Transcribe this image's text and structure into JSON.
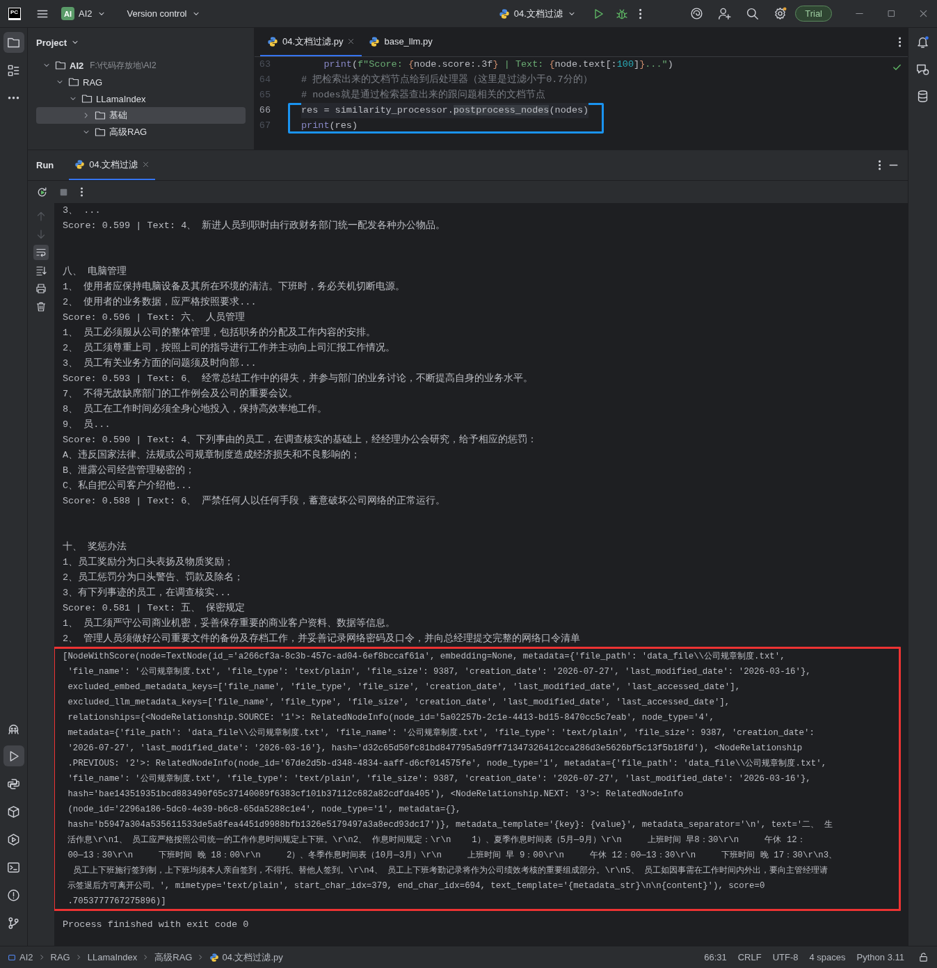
{
  "title_bar": {
    "logo": "PC",
    "project_badge": "AI",
    "project": "AI2",
    "vcs": "Version control",
    "run_config": "04.文档过滤",
    "trial": "Trial"
  },
  "left_strip": {
    "top": [
      {
        "kind": "project",
        "selected": true
      },
      {
        "kind": "structure",
        "selected": false
      },
      {
        "kind": "more",
        "selected": false
      }
    ],
    "bottom": [
      {
        "kind": "ai",
        "selected": false
      },
      {
        "kind": "run",
        "selected": true
      },
      {
        "kind": "python_console",
        "selected": false
      },
      {
        "kind": "packages",
        "selected": false
      },
      {
        "kind": "services",
        "selected": false
      },
      {
        "kind": "terminal",
        "selected": false
      },
      {
        "kind": "problems",
        "selected": false
      },
      {
        "kind": "git",
        "selected": false
      }
    ]
  },
  "project_panel": {
    "title": "Project",
    "tree": [
      {
        "label": "AI2",
        "path": "F:\\代码存放地\\AI2",
        "expanded": true,
        "selected": false,
        "children": [
          {
            "label": "RAG",
            "expanded": true,
            "selected": false,
            "children": [
              {
                "label": "LLamaIndex",
                "expanded": true,
                "selected": false,
                "children": [
                  {
                    "label": "基础",
                    "expanded": false,
                    "selected": true
                  },
                  {
                    "label": "高级RAG",
                    "expanded": true,
                    "selected": false
                  }
                ]
              }
            ]
          }
        ]
      }
    ]
  },
  "editor": {
    "tabs": [
      {
        "label": "04.文档过滤.py",
        "selected": true
      },
      {
        "label": "base_llm.py",
        "selected": false
      }
    ],
    "lines": [
      {
        "number": "63",
        "indented": true,
        "current": false,
        "boxed": false,
        "tokens": [
          {
            "text": "print",
            "kind": "builtin"
          },
          {
            "text": "(",
            "kind": "plain"
          },
          {
            "text": "f\"Score: ",
            "kind": "string"
          },
          {
            "text": "{",
            "kind": "brace"
          },
          {
            "text": "node.score:.3f",
            "kind": "plain"
          },
          {
            "text": "}",
            "kind": "brace"
          },
          {
            "text": " | Text: ",
            "kind": "string"
          },
          {
            "text": "{",
            "kind": "brace"
          },
          {
            "text": "node.text[:",
            "kind": "plain"
          },
          {
            "text": "100",
            "kind": "number"
          },
          {
            "text": "]",
            "kind": "plain"
          },
          {
            "text": "}",
            "kind": "brace"
          },
          {
            "text": "...\"",
            "kind": "string"
          },
          {
            "text": ")",
            "kind": "plain"
          }
        ]
      },
      {
        "number": "64",
        "indented": false,
        "current": false,
        "boxed": false,
        "tokens": [
          {
            "text": "# 把检索出来的文档节点给到后处理器（这里是过滤小于0.7分的）",
            "kind": "comment"
          }
        ]
      },
      {
        "number": "65",
        "indented": false,
        "current": false,
        "boxed": false,
        "tokens": [
          {
            "text": "# nodes就是通过检索器查出来的跟问题相关的文档节点",
            "kind": "comment"
          }
        ]
      },
      {
        "number": "66",
        "indented": false,
        "current": true,
        "boxed": true,
        "tokens": [
          {
            "text": "res = similarity_processor.",
            "kind": "plain"
          },
          {
            "text": "postprocess_nodes",
            "kind": "usage"
          },
          {
            "text": "(nodes)",
            "kind": "plain"
          }
        ]
      },
      {
        "number": "67",
        "indented": false,
        "current": false,
        "boxed": true,
        "tokens": [
          {
            "text": "print",
            "kind": "builtin"
          },
          {
            "text": "(res)",
            "kind": "plain"
          }
        ]
      }
    ]
  },
  "run_panel": {
    "title": "Run",
    "tab": {
      "label": "04.文档过滤",
      "selected": true
    },
    "side_tools": [
      {
        "kind": "up",
        "disabled": true,
        "selected": false
      },
      {
        "kind": "down",
        "disabled": true,
        "selected": false
      },
      {
        "kind": "soft_wrap",
        "disabled": false,
        "selected": true
      },
      {
        "kind": "scroll_end",
        "disabled": false,
        "selected": false
      },
      {
        "kind": "print",
        "disabled": false,
        "selected": false
      },
      {
        "kind": "clear",
        "disabled": false,
        "selected": false
      }
    ],
    "output": [
      {
        "kind": "line",
        "text": "3、 ..."
      },
      {
        "kind": "line",
        "text": "Score: 0.599 | Text: 4、 新进人员到职时由行政财务部门统一配发各种办公物品。"
      },
      {
        "kind": "blank"
      },
      {
        "kind": "blank"
      },
      {
        "kind": "line",
        "text": "八、 电脑管理"
      },
      {
        "kind": "line",
        "text": "1、 使用者应保持电脑设备及其所在环境的清洁。下班时，务必关机切断电源。"
      },
      {
        "kind": "line",
        "text": "2、 使用者的业务数据，应严格按照要求..."
      },
      {
        "kind": "line",
        "text": "Score: 0.596 | Text: 六、 人员管理"
      },
      {
        "kind": "line",
        "text": "1、 员工必须服从公司的整体管理，包括职务的分配及工作内容的安排。"
      },
      {
        "kind": "line",
        "text": "2、 员工须尊重上司，按照上司的指导进行工作并主动向上司汇报工作情况。"
      },
      {
        "kind": "line",
        "text": "3、 员工有关业务方面的问题须及时向部..."
      },
      {
        "kind": "line",
        "text": "Score: 0.593 | Text: 6、 经常总结工作中的得失，并参与部门的业务讨论，不断提高自身的业务水平。"
      },
      {
        "kind": "line",
        "text": "7、 不得无故缺席部门的工作例会及公司的重要会议。"
      },
      {
        "kind": "line",
        "text": "8、 员工在工作时间必须全身心地投入，保持高效率地工作。"
      },
      {
        "kind": "line",
        "text": "9、 员..."
      },
      {
        "kind": "line",
        "text": "Score: 0.590 | Text: 4、下列事由的员工，在调查核实的基础上，经经理办公会研究，给予相应的惩罚："
      },
      {
        "kind": "line",
        "text": "A、违反国家法律、法规或公司规章制度造成经济损失和不良影响的；"
      },
      {
        "kind": "line",
        "text": "B、泄露公司经营管理秘密的；"
      },
      {
        "kind": "line",
        "text": "C、私自把公司客户介绍他..."
      },
      {
        "kind": "line",
        "text": "Score: 0.588 | Text: 6、 严禁任何人以任何手段，蓄意破坏公司网络的正常运行。"
      },
      {
        "kind": "blank"
      },
      {
        "kind": "blank"
      },
      {
        "kind": "line",
        "text": "十、 奖惩办法"
      },
      {
        "kind": "line",
        "text": "1、员工奖励分为口头表扬及物质奖励；"
      },
      {
        "kind": "line",
        "text": "2、员工惩罚分为口头警告、罚款及除名；"
      },
      {
        "kind": "line",
        "text": "3、有下列事迹的员工，在调查核实..."
      },
      {
        "kind": "line",
        "text": "Score: 0.581 | Text: 五、 保密规定"
      },
      {
        "kind": "line",
        "text": "1、 员工须严守公司商业机密，妥善保存重要的商业客户资料、数据等信息。"
      },
      {
        "kind": "line",
        "text": "2、 管理人员须做好公司重要文件的备份及存档工作，并妥善记录网络密码及口令，并向总经理提交完整的网络口令清单"
      }
    ],
    "result": [
      "[NodeWithScore(node=TextNode(id_='a266cf3a-8c3b-457c-ad04-6ef8bccaf61a', embedding=None, metadata={'file_path': 'data_file\\\\公司规章制度.txt',",
      " 'file_name': '公司规章制度.txt', 'file_type': 'text/plain', 'file_size': 9387, 'creation_date': '2026-07-27', 'last_modified_date': '2026-03-16'},",
      " excluded_embed_metadata_keys=['file_name', 'file_type', 'file_size', 'creation_date', 'last_modified_date', 'last_accessed_date'],",
      " excluded_llm_metadata_keys=['file_name', 'file_type', 'file_size', 'creation_date', 'last_modified_date', 'last_accessed_date'],",
      " relationships={<NodeRelationship.SOURCE: '1'>: RelatedNodeInfo(node_id='5a02257b-2c1e-4413-bd15-8470cc5c7eab', node_type='4',",
      " metadata={'file_path': 'data_file\\\\公司规章制度.txt', 'file_name': '公司规章制度.txt', 'file_type': 'text/plain', 'file_size': 9387, 'creation_date':",
      " '2026-07-27', 'last_modified_date': '2026-03-16'}, hash='d32c65d50fc81bd847795a5d9ff71347326412cca286d3e5626bf5c13f5b18fd'), <NodeRelationship",
      " .PREVIOUS: '2'>: RelatedNodeInfo(node_id='67de2d5b-d348-4834-aaff-d6cf014575fe', node_type='1', metadata={'file_path': 'data_file\\\\公司规章制度.txt',",
      " 'file_name': '公司规章制度.txt', 'file_type': 'text/plain', 'file_size': 9387, 'creation_date': '2026-07-27', 'last_modified_date': '2026-03-16'},",
      " hash='bae143519351bcd883490f65c37140089f6383cf101b37112c682a82cdfda405'), <NodeRelationship.NEXT: '3'>: RelatedNodeInfo",
      " (node_id='2296a186-5dc0-4e39-b6c8-65da5288c1e4', node_type='1', metadata={},",
      " hash='b5947a304a535611533de5a8fea4451d9988bfb1326e5179497a3a8ecd93dc17')}, metadata_template='{key}: {value}', metadata_separator='\\n', text='二、 生",
      " 活作息\\r\\n1、 员工应严格按照公司统一的工作作息时间规定上下班。\\r\\n2、 作息时间规定：\\r\\n    1）、夏季作息时间表（5月—9月）\\r\\n     上班时间 早8：30\\r\\n     午休 12：",
      " 00—13：30\\r\\n     下班时间 晚 18：00\\r\\n     2）、冬季作息时间表（10月—3月）\\r\\n     上班时间 早 9：00\\r\\n     午休 12：00—13：30\\r\\n     下班时间 晚 17：30\\r\\n3、",
      "  员工上下班施行签到制，上下班均须本人亲自签到，不得托、替他人签到。\\r\\n4、 员工上下班考勤记录将作为公司绩效考核的重要组成部分。\\r\\n5、 员工如因事需在工作时间内外出，要向主管经理请",
      " 示签退后方可离开公司。', mimetype='text/plain', start_char_idx=379, end_char_idx=694, text_template='{metadata_str}\\n\\n{content}'), score=0",
      " .7053777767275896)]"
    ],
    "exit": "Process finished with exit code 0"
  },
  "status_bar": {
    "breadcrumbs": [
      {
        "label": "AI2",
        "kind": "module"
      },
      {
        "label": "RAG",
        "kind": "folder"
      },
      {
        "label": "LLamaIndex",
        "kind": "folder"
      },
      {
        "label": "高级RAG",
        "kind": "folder"
      },
      {
        "label": "04.文档过滤.py",
        "kind": "python_file"
      }
    ],
    "position": "66:31",
    "line_ending": "CRLF",
    "encoding": "UTF-8",
    "indent": "4 spaces",
    "interpreter": "Python 3.11"
  }
}
